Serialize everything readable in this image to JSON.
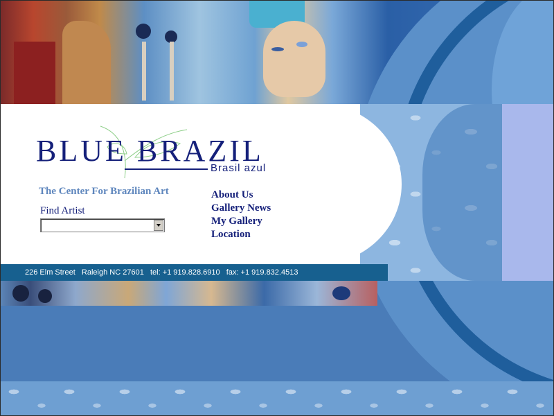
{
  "logo": {
    "title": "BLUE BRAZIL",
    "subtitle": "Brasil azul"
  },
  "tagline": "The Center For Brazilian Art",
  "find_artist": {
    "label": "Find Artist",
    "selected": ""
  },
  "nav": {
    "items": [
      {
        "label": "About Us"
      },
      {
        "label": "Gallery News"
      },
      {
        "label": "My Gallery"
      },
      {
        "label": "Location"
      }
    ]
  },
  "footer": {
    "address": "226 Elm Street   Raleigh NC 27601   tel: +1 919.828.6910   fax: +1 919.832.4513"
  },
  "colors": {
    "brand_navy": "#15207a",
    "tagline_blue": "#5e86bd",
    "address_bar": "#17608f",
    "background_blue": "#4a7cb8"
  }
}
